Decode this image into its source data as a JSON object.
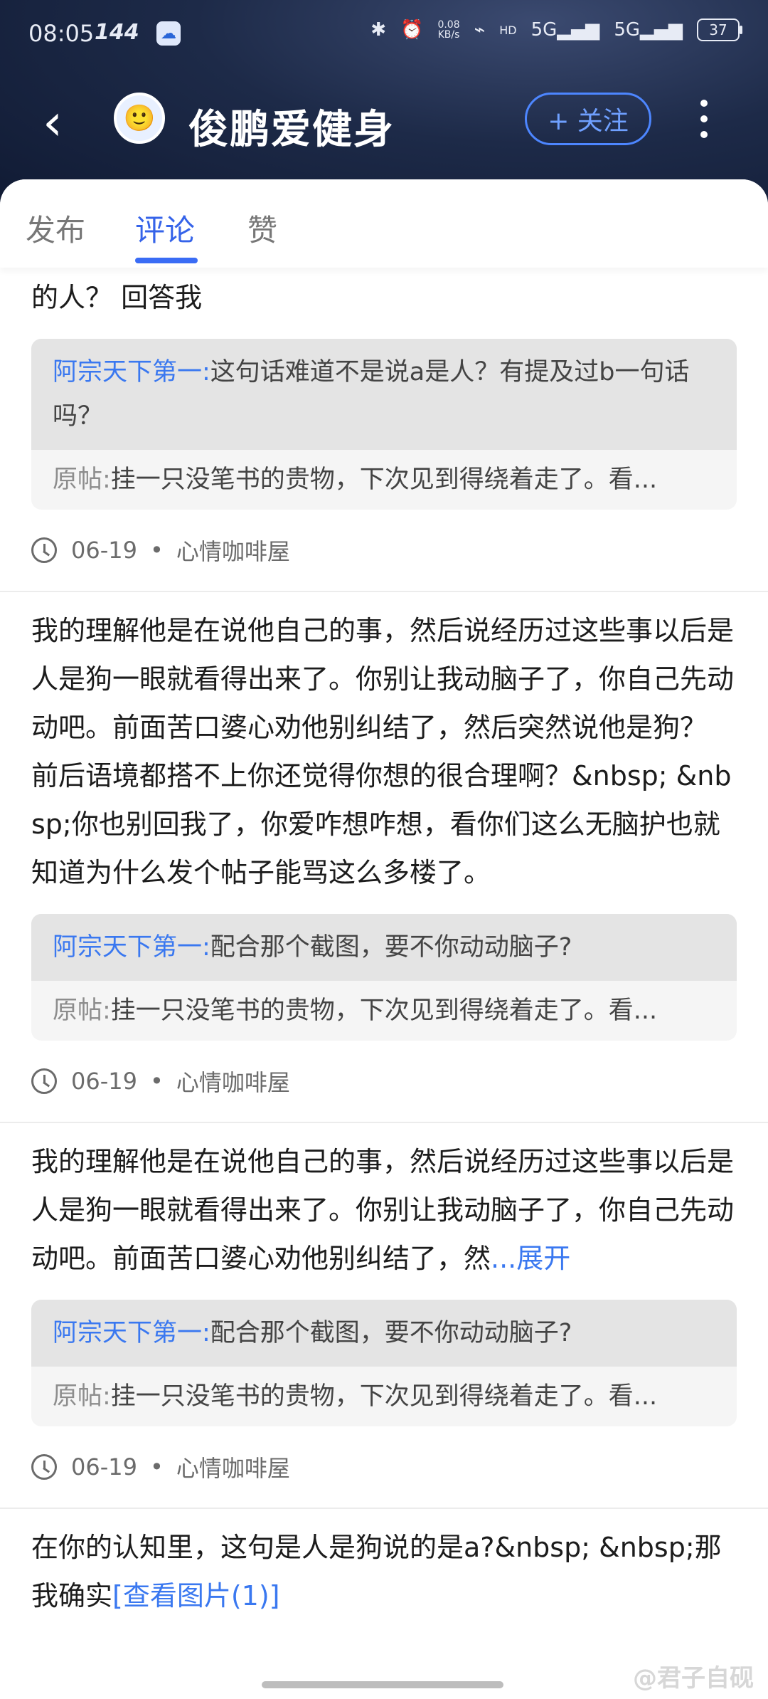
{
  "status_bar": {
    "time": "08:05",
    "refresh": "144",
    "net_speed_top": "0.08",
    "net_speed_bottom": "KB/s",
    "battery": "37"
  },
  "header": {
    "back_icon": "back-chevron-icon",
    "title": "俊鹏爱健身",
    "follow_label": "+ 关注",
    "more_icon": "more-vertical-icon"
  },
  "tabs": [
    "发布",
    "评论",
    "赞"
  ],
  "posts": [
    {
      "text": "的人？ 回答我",
      "reply_user": "阿宗天下第一:",
      "reply_text": "这句话难道不是说a是人？有提及过b一句话吗？",
      "orig_label": "原帖:",
      "orig_text": "挂一只没笔书的贵物，下次见到得绕着走了。看...",
      "date": "06-19",
      "board": "心情咖啡屋"
    },
    {
      "text": "我的理解他是在说他自己的事，然后说经历过这些事以后是人是狗一眼就看得出来了。你别让我动脑子了，你自己先动动吧。前面苦口婆心劝他别纠结了，然后突然说他是狗？ 前后语境都搭不上你还觉得你想的很合理啊？&nbsp; &nbsp;你也别回我了，你爱咋想咋想，看你们这么无脑护也就知道为什么发个帖子能骂这么多楼了。",
      "reply_user": "阿宗天下第一:",
      "reply_text": "配合那个截图，要不你动动脑子?",
      "orig_label": "原帖:",
      "orig_text": "挂一只没笔书的贵物，下次见到得绕着走了。看...",
      "date": "06-19",
      "board": "心情咖啡屋"
    },
    {
      "text": "我的理解他是在说他自己的事，然后说经历过这些事以后是人是狗一眼就看得出来了。你别让我动脑子了，你自己先动动吧。前面苦口婆心劝他别纠结了，然",
      "expand": "...展开",
      "reply_user": "阿宗天下第一:",
      "reply_text": "配合那个截图，要不你动动脑子?",
      "orig_label": "原帖:",
      "orig_text": "挂一只没笔书的贵物，下次见到得绕着走了。看...",
      "date": "06-19",
      "board": "心情咖啡屋"
    },
    {
      "text": "在你的认知里，这句是人是狗说的是a?&nbsp; &nbsp;那我确实",
      "link": "[查看图片(1)]"
    }
  ],
  "watermark": "@君子自砚",
  "colors": {
    "accent": "#3a78f0",
    "header_bg": "#1d2a48"
  }
}
